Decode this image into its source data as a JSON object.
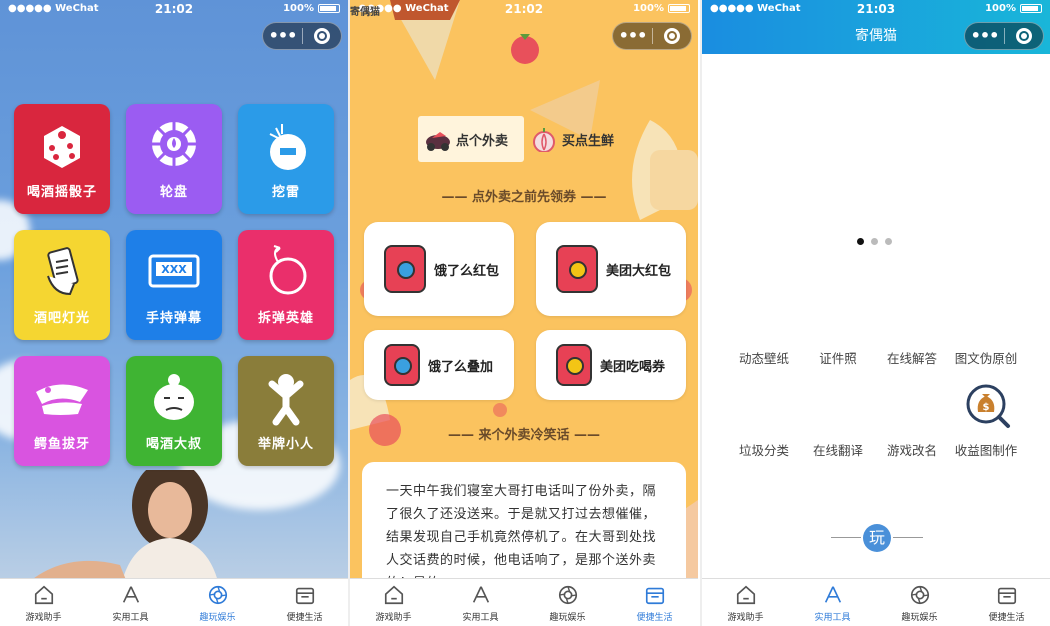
{
  "status": {
    "carrier": "●●●●● WeChat",
    "battery": "100%"
  },
  "screen1": {
    "time": "21:02",
    "tiles": [
      {
        "label": "喝酒摇骰子",
        "color": "#d9263e",
        "icon": "dice-icon"
      },
      {
        "label": "轮盘",
        "color": "#9b5cf2",
        "icon": "wheel-icon"
      },
      {
        "label": "挖雷",
        "color": "#2b9be8",
        "icon": "mine-icon"
      },
      {
        "label": "酒吧灯光",
        "color": "#f5d631",
        "icon": "phone-hand-icon"
      },
      {
        "label": "手持弹幕",
        "color": "#1e7fe8",
        "icon": "marquee-icon"
      },
      {
        "label": "拆弹英雄",
        "color": "#ea2f6b",
        "icon": "bomb-icon"
      },
      {
        "label": "鳄鱼拔牙",
        "color": "#d954e0",
        "icon": "crocodile-icon"
      },
      {
        "label": "喝酒大叔",
        "color": "#3fb433",
        "icon": "uncle-icon"
      },
      {
        "label": "举牌小人",
        "color": "#8a7d3a",
        "icon": "jumping-man-icon"
      }
    ],
    "tabs": [
      "游戏助手",
      "实用工具",
      "趣玩娱乐",
      "便捷生活"
    ],
    "active_tab": 2
  },
  "screen2": {
    "time": "21:02",
    "overlay_title": "寄偶猫",
    "segments": [
      "点个外卖",
      "买点生鲜"
    ],
    "coupon_heading": "—— 点外卖之前先领券 ——",
    "coupons": [
      {
        "label": "饿了么红包",
        "seal": "e"
      },
      {
        "label": "美团大红包",
        "seal": "美团"
      },
      {
        "label": "饿了么叠加",
        "seal": "e"
      },
      {
        "label": "美团吃喝券",
        "seal": "美团"
      }
    ],
    "joke_heading": "—— 来个外卖冷笑话 ——",
    "joke": "一天中午我们寝室大哥打电话叫了份外卖，隔了很久了还没送来。于是就又打过去想催催，结果发现自己手机竟然停机了。在大哥到处找人交话费的时候，他电话响了，是那个送外卖的！是的，",
    "tabs": [
      "游戏助手",
      "实用工具",
      "趣玩娱乐",
      "便捷生活"
    ],
    "active_tab": 3
  },
  "screen3": {
    "time": "21:03",
    "title": "寄偶猫",
    "row1": [
      "动态壁纸",
      "证件照",
      "在线解答",
      "图文伪原创"
    ],
    "row2": [
      "垃圾分类",
      "在线翻译",
      "游戏改名",
      "收益图制作"
    ],
    "play_label": "玩",
    "tabs": [
      "游戏助手",
      "实用工具",
      "趣玩娱乐",
      "便捷生活"
    ],
    "active_tab": 1
  }
}
